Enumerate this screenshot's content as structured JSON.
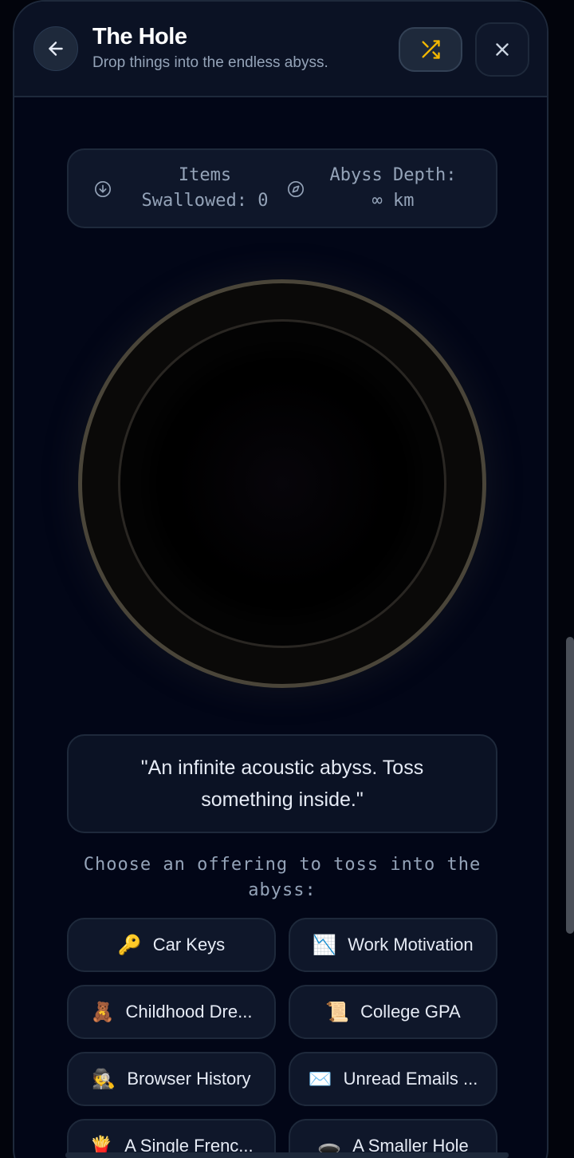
{
  "header": {
    "title": "The Hole",
    "subtitle": "Drop things into the endless abyss."
  },
  "stats": {
    "items_label_line1": "Items",
    "items_label_line2": "Swallowed: 0",
    "depth_label_line1": "Abyss Depth:",
    "depth_label_line2": "∞ km"
  },
  "quote": "\"An infinite acoustic abyss. Toss something inside.\"",
  "prompt": "Choose an offering to toss into the abyss:",
  "offerings": [
    {
      "emoji": "🔑",
      "label": "Car Keys"
    },
    {
      "emoji": "📉",
      "label": "Work Motivation"
    },
    {
      "emoji": "🧸",
      "label": "Childhood Dre..."
    },
    {
      "emoji": "📜",
      "label": "College GPA"
    },
    {
      "emoji": "🕵️",
      "label": "Browser History"
    },
    {
      "emoji": "✉️",
      "label": "Unread Emails ..."
    },
    {
      "emoji": "🍟",
      "label": "A Single Frenc..."
    },
    {
      "emoji": "🕳️",
      "label": "A Smaller Hole"
    }
  ],
  "colors": {
    "accent": "#f5b800",
    "background": "#020617",
    "card": "#0f172a",
    "border": "#1e293b",
    "rim": "#4a4539"
  },
  "icons": {
    "back": "arrow-left-icon",
    "shuffle": "shuffle-icon",
    "close": "close-icon",
    "items": "arrow-down-circle-icon",
    "depth": "compass-icon"
  }
}
